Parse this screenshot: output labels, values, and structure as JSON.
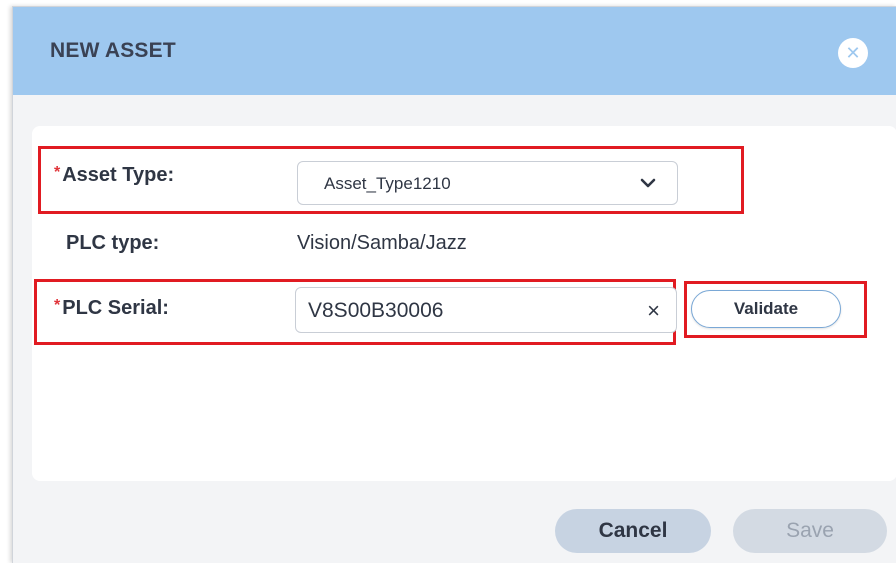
{
  "dialog": {
    "title": "NEW ASSET",
    "close_icon": "close-icon"
  },
  "form": {
    "required_marker": "*",
    "asset_type": {
      "label": "Asset Type:",
      "selected_value": "Asset_Type1210",
      "icon": "chevron-down-icon"
    },
    "plc_type": {
      "label": "PLC type:",
      "value": "Vision/Samba/Jazz"
    },
    "plc_serial": {
      "label": "PLC Serial:",
      "value": "V8S00B30006",
      "clear_glyph": "×"
    },
    "validate_label": "Validate"
  },
  "footer": {
    "cancel_label": "Cancel",
    "save_label": "Save"
  },
  "colors": {
    "header": "#9ec8ef",
    "highlight": "#e11b22",
    "required": "#e0343a"
  }
}
